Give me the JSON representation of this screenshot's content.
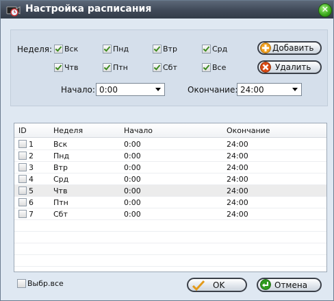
{
  "window": {
    "title": "Настройка расписания",
    "close_glyph": "✕"
  },
  "week": {
    "label": "Неделя:",
    "days": [
      {
        "label": "Вск",
        "checked": true
      },
      {
        "label": "Пнд",
        "checked": true
      },
      {
        "label": "Втр",
        "checked": true
      },
      {
        "label": "Срд",
        "checked": true
      },
      {
        "label": "Чтв",
        "checked": true
      },
      {
        "label": "Птн",
        "checked": true
      },
      {
        "label": "Сбт",
        "checked": true
      },
      {
        "label": "Все",
        "checked": true
      }
    ]
  },
  "buttons": {
    "add": "Добавить",
    "delete": "Удалить",
    "ok": "OK",
    "cancel": "Отмена"
  },
  "start": {
    "label": "Начало:",
    "value": "0:00"
  },
  "end": {
    "label": "Окончание:",
    "value": "24:00"
  },
  "table": {
    "headers": [
      "ID",
      "Неделя",
      "Начало",
      "Окончание"
    ],
    "rows": [
      {
        "id": "1",
        "day": "Вск",
        "start": "0:00",
        "end": "24:00"
      },
      {
        "id": "2",
        "day": "Пнд",
        "start": "0:00",
        "end": "24:00"
      },
      {
        "id": "3",
        "day": "Втр",
        "start": "0:00",
        "end": "24:00"
      },
      {
        "id": "4",
        "day": "Срд",
        "start": "0:00",
        "end": "24:00"
      },
      {
        "id": "5",
        "day": "Чтв",
        "start": "0:00",
        "end": "24:00"
      },
      {
        "id": "6",
        "day": "Птн",
        "start": "0:00",
        "end": "24:00"
      },
      {
        "id": "7",
        "day": "Сбт",
        "start": "0:00",
        "end": "24:00"
      }
    ],
    "selected_row_id": "5"
  },
  "select_all": {
    "label": "Выбр.все",
    "checked": false
  },
  "colors": {
    "titlebar": "#3f4958",
    "panel": "#dfe8f2",
    "accent_green": "#3aa81c",
    "add_icon": "#f0a020",
    "delete_icon": "#d84a14"
  },
  "icons": {
    "app": "camera-clock-icon",
    "close": "close-icon",
    "add": "plus-icon",
    "delete": "x-icon",
    "ok": "checkmark-icon",
    "cancel": "return-arrow-icon"
  }
}
